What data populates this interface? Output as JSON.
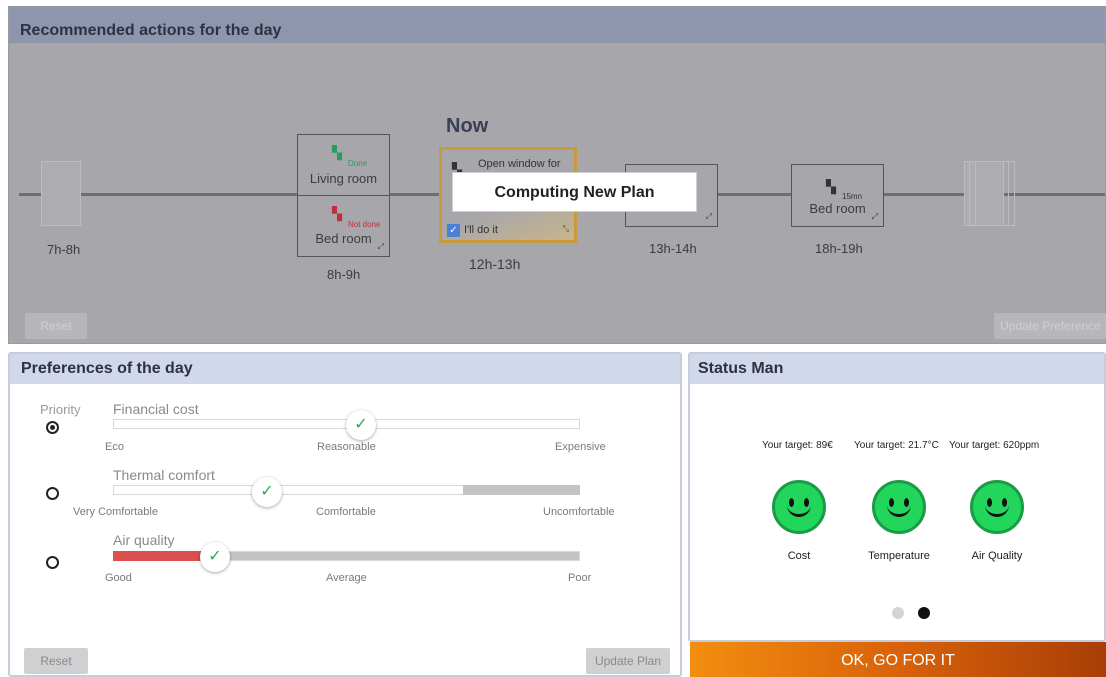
{
  "top": {
    "title": "Recommended actions for the day",
    "now": "Now",
    "reset": "Reset",
    "update_preferences": "Update Preference",
    "popup": "Computing New Plan",
    "slots": {
      "s7": {
        "time": "7h-8h"
      },
      "s8": {
        "time": "8h-9h",
        "living": {
          "label": "Living room",
          "status": "Done"
        },
        "bed": {
          "label": "Bed room",
          "status": "Not done"
        }
      },
      "s12": {
        "time": "12h-13h",
        "action": "Open window for",
        "checkbox": "I'll do it"
      },
      "s13": {
        "time": "13h-14h"
      },
      "s18": {
        "time": "18h-19h",
        "label": "Bed room",
        "tag": "15mn"
      }
    }
  },
  "preferences": {
    "title": "Preferences of the day",
    "priority": "Priority",
    "reset": "Reset",
    "update": "Update Plan",
    "sliders": [
      {
        "name": "Financial cost",
        "ticks": [
          "Eco",
          "Reasonable",
          "Expensive"
        ],
        "value": 0.5,
        "priority_selected": true
      },
      {
        "name": "Thermal comfort",
        "ticks": [
          "Very Comfortable",
          "Comfortable",
          "Uncomfortable"
        ],
        "value": 0.33,
        "priority_selected": false
      },
      {
        "name": "Air quality",
        "ticks": [
          "Good",
          "Average",
          "Poor"
        ],
        "value": 0.22,
        "priority_selected": false
      }
    ]
  },
  "status": {
    "title": "Status Man",
    "targets": [
      "Your target: 89€",
      "Your target: 21.7°C",
      "Your target: 620ppm"
    ],
    "labels": [
      "Cost",
      "Temperature",
      "Air Quality"
    ],
    "page": 2,
    "pages": 2
  },
  "go_button": "OK, GO FOR IT",
  "colors": {
    "accent_green": "#22d65b",
    "go_orange": "#f28e0f",
    "bad_red": "#d9504f"
  }
}
